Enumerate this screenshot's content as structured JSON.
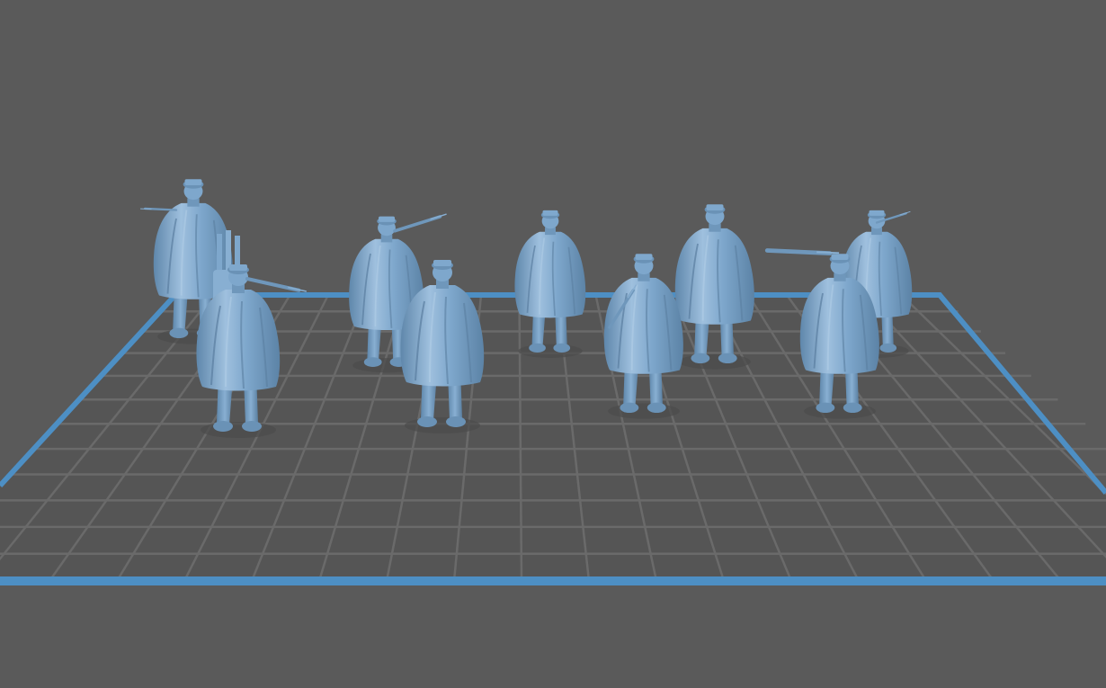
{
  "viewport": {
    "background_color": "#5a5a5a",
    "plate_fill_color": "#555555",
    "grid_line_color": "#6a6a6a",
    "plate_border_color": "#4d8fc4",
    "model_color": "#7ea7cc",
    "model_shade_color": "#5f87ab",
    "model_highlight_color": "#a9c8e4",
    "model_count": 9,
    "grid_columns": 20,
    "grid_rows": 12
  }
}
